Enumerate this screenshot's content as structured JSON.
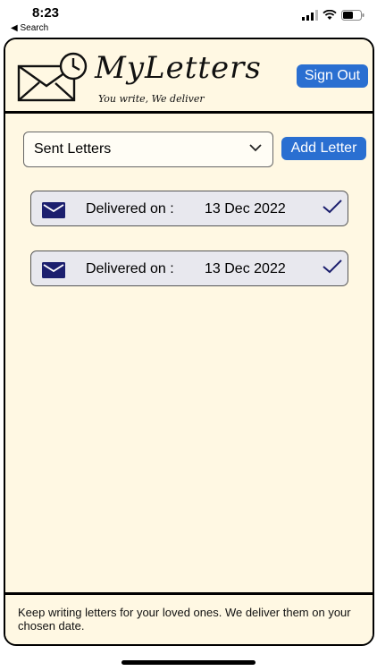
{
  "status_bar": {
    "time": "8:23",
    "back_label": "◀ Search"
  },
  "header": {
    "app_name": "MyLetters",
    "tagline": "You write, We deliver",
    "sign_out_label": "Sign Out",
    "logo_icon": "envelope-clock-icon"
  },
  "toolbar": {
    "filter_selected": "Sent Letters",
    "add_letter_label": "Add Letter"
  },
  "letters": [
    {
      "label": "Delivered on :",
      "date": "13 Dec 2022",
      "icon": "envelope-icon",
      "status_icon": "checkmark-icon"
    },
    {
      "label": "Delivered on :",
      "date": "13 Dec 2022",
      "icon": "envelope-icon",
      "status_icon": "checkmark-icon"
    }
  ],
  "footer": {
    "message": "Keep writing letters for your loved ones. We deliver them on your chosen date."
  },
  "colors": {
    "accent": "#2a6fd1",
    "background": "#fff8e3",
    "envelope": "#1c1f6e",
    "checkmark": "#1c1f6e"
  }
}
